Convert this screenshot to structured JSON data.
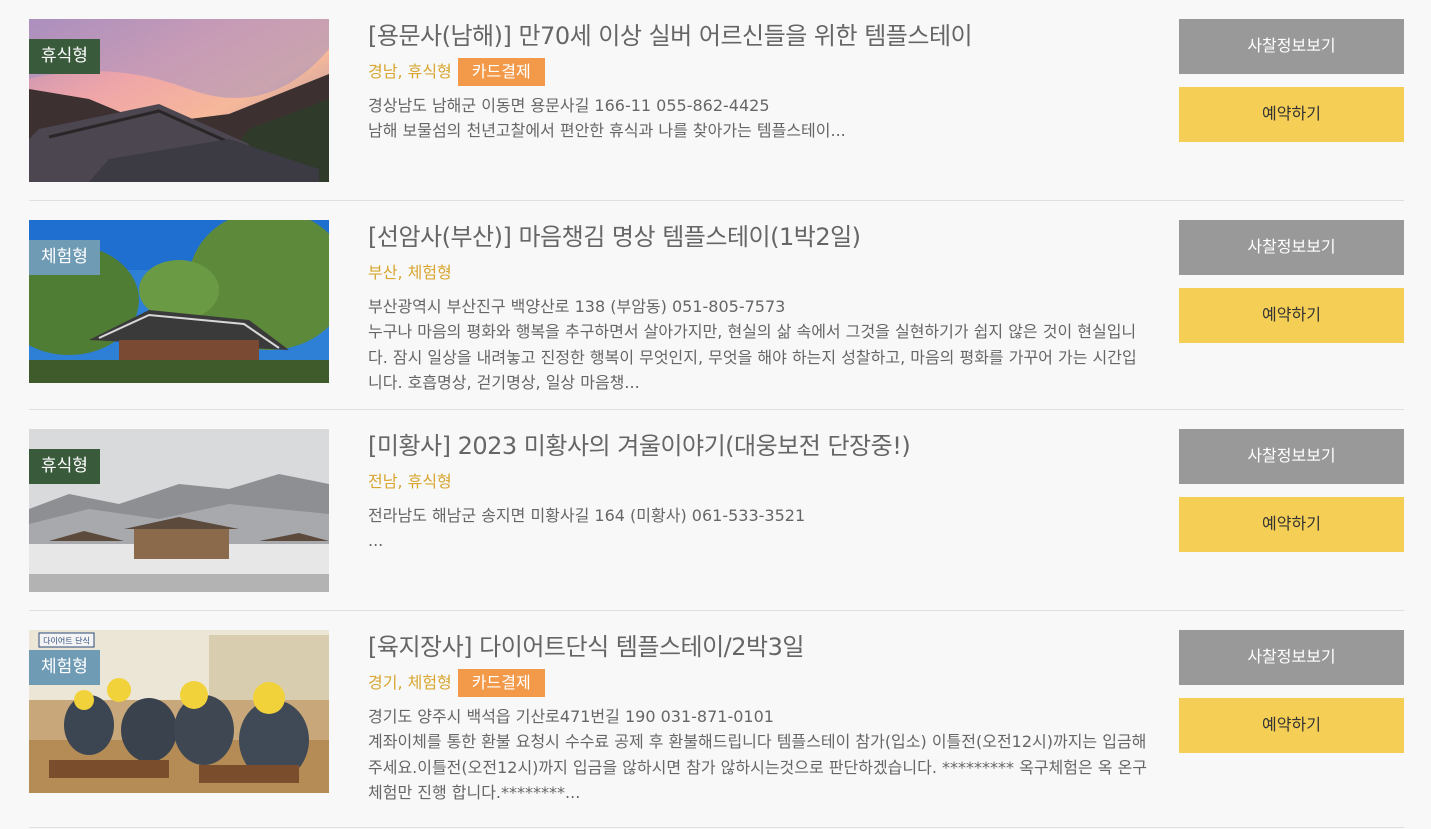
{
  "colors": {
    "rest_badge": "#3a5a3c",
    "experience_badge": "#6f9bb5",
    "region_text": "#d8a631",
    "card_badge": "#f39a4a",
    "info_button": "#999999",
    "reserve_button": "#f5cf55"
  },
  "items": [
    {
      "type_badge": "휴식형",
      "title": "[용문사(남해)] 만70세 이상 실버 어르신들을 위한 템플스테이",
      "region": "경남, 휴식형",
      "card_badge": "카드결제",
      "address": "경상남도 남해군 이동면 용문사길 166-11 055-862-4425",
      "description": "남해 보물섬의 천년고찰에서 편안한 휴식과 나를 찾아가는 템플스테이...",
      "info_button": "사찰정보보기",
      "reserve_button": "예약하기"
    },
    {
      "type_badge": "체험형",
      "title": "[선암사(부산)] 마음챙김 명상 템플스테이(1박2일)",
      "region": "부산, 체험형",
      "address": "부산광역시 부산진구 백양산로 138 (부암동) 051-805-7573",
      "description": "누구나 마음의 평화와 행복을 추구하면서 살아가지만, 현실의 삶 속에서 그것을 실현하기가 쉽지 않은 것이 현실입니다. 잠시 일상을 내려놓고 진정한 행복이 무엇인지, 무엇을 해야 하는지 성찰하고, 마음의 평화를 가꾸어 가는 시간입니다. 호흡명상, 걷기명상, 일상 마음챙...",
      "info_button": "사찰정보보기",
      "reserve_button": "예약하기"
    },
    {
      "type_badge": "휴식형",
      "title": "[미황사] 2023 미황사의 겨울이야기(대웅보전 단장중!)",
      "region": "전남, 휴식형",
      "address": "전라남도 해남군 송지면 미황사길 164 (미황사) 061-533-3521",
      "description": "...",
      "info_button": "사찰정보보기",
      "reserve_button": "예약하기"
    },
    {
      "type_badge": "체험형",
      "title": "[육지장사] 다이어트단식 템플스테이/2박3일",
      "region": "경기, 체험형",
      "card_badge": "카드결제",
      "address": "경기도 양주시 백석읍 기산로471번길 190 031-871-0101",
      "description": "계좌이체를 통한 환불 요청시 수수료 공제 후 환불해드립니다 템플스테이 참가(입소) 이틀전(오전12시)까지는 입금해주세요.이틀전(오전12시)까지 입금을 않하시면 참가 않하시는것으로 판단하겠습니다. ********* 옥구체험은 옥 온구체험만 진행 합니다.********...",
      "info_button": "사찰정보보기",
      "reserve_button": "예약하기",
      "photo_text": "다이어트 단식"
    }
  ]
}
